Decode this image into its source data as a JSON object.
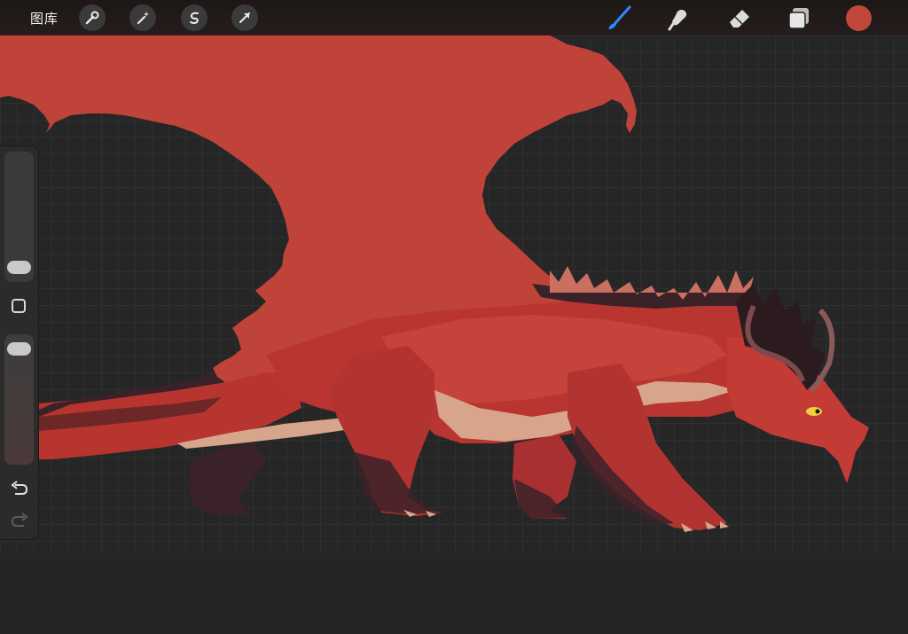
{
  "toolbar": {
    "gallery_label": "图库",
    "left_tools": [
      "wrench-icon",
      "magic-wand-icon",
      "selection-s-icon",
      "transform-arrow-icon"
    ],
    "right_tools": [
      "brush-icon",
      "smudge-icon",
      "eraser-icon",
      "layers-icon"
    ],
    "active_tool": "brush-icon",
    "current_color": "#c0473b"
  },
  "sidebar": {
    "brush_size_level": 0.05,
    "opacity_level": 0.95,
    "modify_button": "square-modify-icon",
    "undo": "undo-icon",
    "redo": "redo-icon"
  },
  "colors": {
    "accent_active": "#2b8cff",
    "wing": "#c0433a",
    "body": "#b8352f",
    "belly": "#d7a58c",
    "dark": "#3a2228"
  }
}
